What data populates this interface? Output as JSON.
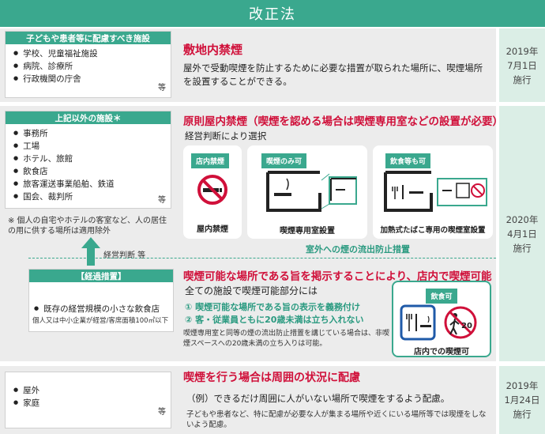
{
  "header": {
    "title": "改正法"
  },
  "section1": {
    "label": "子どもや患者等に配慮すべき施設",
    "items": [
      "学校、児童福祉施設",
      "病院、診療所",
      "行政機関の庁舎"
    ],
    "etc": "等",
    "title": "敷地内禁煙",
    "description": "屋外で受動喫煙を防止するために必要な措置が取られた場所に、喫煙場所を設置することができる。",
    "date": [
      "2019年",
      "7月1日",
      "施行"
    ]
  },
  "section2": {
    "label": "上記以外の施設＊",
    "items": [
      "事務所",
      "工場",
      "ホテル、旅館",
      "飲食店",
      "旅客運送事業船舶、鉄道",
      "国会、裁判所"
    ],
    "etc": "等",
    "note": "※ 個人の自宅やホテルの客室など、人の居住の用に供する場所は適用除外",
    "title": "原則屋内禁煙（喫煙を認める場合は喫煙専用室などの設置が必要）",
    "subtitle": "経営判断により選択",
    "cards": [
      {
        "tag": "店内禁煙",
        "caption": "屋内禁煙"
      },
      {
        "tag": "喫煙のみ可",
        "caption": "喫煙専用室設置"
      },
      {
        "tag": "飲食等も可",
        "caption": "加熱式たばこ専用の喫煙室設置"
      }
    ],
    "outdoor_note": "室外への煙の流出防止措置",
    "arrow_label": "経営判断 等",
    "date": [
      "2020年",
      "4月1日",
      "施行"
    ]
  },
  "transition": {
    "label": "【経過措置】",
    "item": "既存の経営規模の小さな飲食店",
    "sub": "個人又は中小企業が経営/客席面積100㎡以下",
    "title": "喫煙可能な場所である旨を掲示することにより、店内で喫煙可能",
    "lead": "全ての施設で喫煙可能部分には",
    "points": [
      "①  喫煙可能な場所である旨の表示を義務付け",
      "②  客・従業員ともに20歳未満は立ち入れない"
    ],
    "footnote": "喫煙専用室と同等の煙の流出防止措置を講じている場合は、非喫煙スペースへの20歳未満の立ち入りは可能。",
    "card_tag": "飲食可",
    "card_caption": "店内での喫煙可",
    "sign_number": "20"
  },
  "section3": {
    "items": [
      "屋外",
      "家庭"
    ],
    "etc": "等",
    "title": "喫煙を行う場合は周囲の状況に配慮",
    "example": "（例）できるだけ周囲に人がいない場所で喫煙をするよう配慮。",
    "note": "子どもや患者など、特に配慮が必要な人が集まる場所や近くにいる場所等では喫煙をしないよう配慮。",
    "date": [
      "2019年",
      "1月24日",
      "施行"
    ]
  }
}
